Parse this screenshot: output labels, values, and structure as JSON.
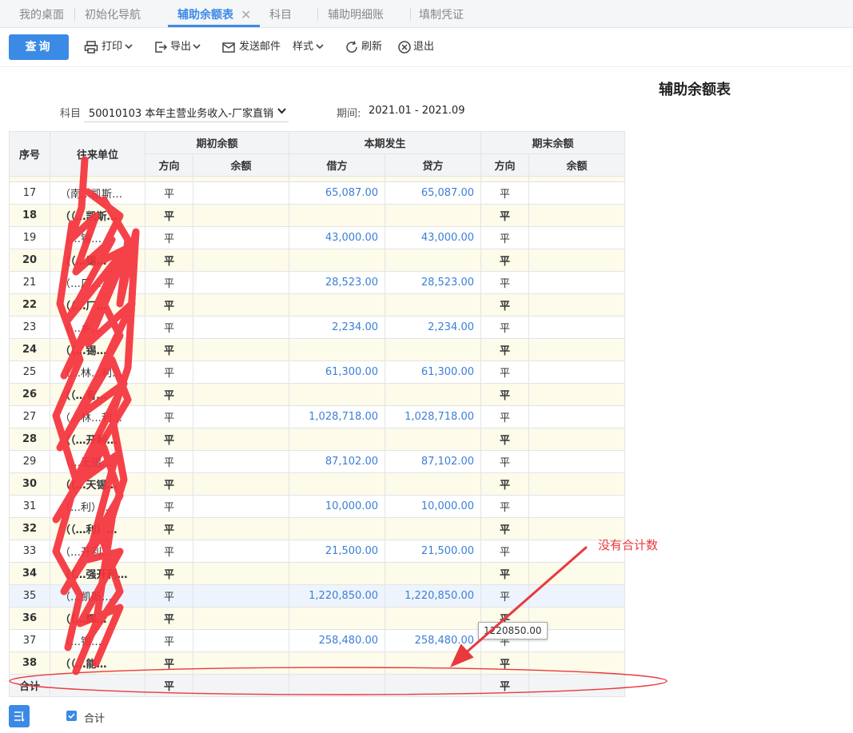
{
  "tabs": [
    {
      "label": "我的桌面"
    },
    {
      "label": "初始化导航"
    },
    {
      "label": "辅助余额表"
    },
    {
      "label": "科目"
    },
    {
      "label": "辅助明细账"
    },
    {
      "label": "填制凭证"
    }
  ],
  "toolbar": {
    "query": "查询",
    "print": "打印",
    "export": "导出",
    "email": "发送邮件",
    "style": "样式",
    "refresh": "刷新",
    "exit": "退出"
  },
  "report": {
    "title": "辅助余额表",
    "subject_label": "科目",
    "subject_value": "50010103 本年主营业务收入-厂家直销",
    "period_label": "期间:",
    "period_value": "2021.01 - 2021.09"
  },
  "table": {
    "headers": {
      "index": "序号",
      "partner": "往来单位",
      "opening": "期初余额",
      "current": "本期发生",
      "closing": "期末余额",
      "direction": "方向",
      "balance": "余额",
      "debit": "借方",
      "credit": "贷方"
    },
    "rows": [
      {
        "idx": "17",
        "name": "（南…凯斯…",
        "dir": "平",
        "debit": "65,087.00",
        "credit": "65,087.00",
        "cdir": "平"
      },
      {
        "idx": "18",
        "name": "（（…凯斯…",
        "dir": "平",
        "debit": "",
        "credit": "",
        "cdir": "平"
      },
      {
        "idx": "19",
        "name": "（…锡…",
        "dir": "平",
        "debit": "43,000.00",
        "credit": "43,000.00",
        "cdir": "平"
      },
      {
        "idx": "20",
        "name": "（（…锡…",
        "dir": "平",
        "debit": "",
        "credit": "",
        "cdir": "平"
      },
      {
        "idx": "21",
        "name": "（…厂…",
        "dir": "平",
        "debit": "28,523.00",
        "credit": "28,523.00",
        "cdir": "平"
      },
      {
        "idx": "22",
        "name": "（（…厂…",
        "dir": "平",
        "debit": "",
        "credit": "",
        "cdir": "平"
      },
      {
        "idx": "23",
        "name": "（…乡…",
        "dir": "平",
        "debit": "2,234.00",
        "credit": "2,234.00",
        "cdir": "平"
      },
      {
        "idx": "24",
        "name": "（（…锡…",
        "dir": "平",
        "debit": "",
        "credit": "",
        "cdir": "平"
      },
      {
        "idx": "25",
        "name": "（…林…利…",
        "dir": "平",
        "debit": "61,300.00",
        "credit": "61,300.00",
        "cdir": "平"
      },
      {
        "idx": "26",
        "name": "（（…有…",
        "dir": "平",
        "debit": "",
        "credit": "",
        "cdir": "平"
      },
      {
        "idx": "27",
        "name": "（…林…利…",
        "dir": "平",
        "debit": "1,028,718.00",
        "credit": "1,028,718.00",
        "cdir": "平"
      },
      {
        "idx": "28",
        "name": "（（…开利…",
        "dir": "平",
        "debit": "",
        "credit": "",
        "cdir": "平"
      },
      {
        "idx": "29",
        "name": "（…无锡…",
        "dir": "平",
        "debit": "87,102.00",
        "credit": "87,102.00",
        "cdir": "平"
      },
      {
        "idx": "30",
        "name": "（（…天锡…",
        "dir": "平",
        "debit": "",
        "credit": "",
        "cdir": "平"
      },
      {
        "idx": "31",
        "name": "（…利）…",
        "dir": "平",
        "debit": "10,000.00",
        "credit": "10,000.00",
        "cdir": "平"
      },
      {
        "idx": "32",
        "name": "（（…利）…",
        "dir": "平",
        "debit": "",
        "credit": "",
        "cdir": "平"
      },
      {
        "idx": "33",
        "name": "（…开利…",
        "dir": "平",
        "debit": "21,500.00",
        "credit": "21,500.00",
        "cdir": "平"
      },
      {
        "idx": "34",
        "name": "（（…强开利…",
        "dir": "平",
        "debit": "",
        "credit": "",
        "cdir": "平"
      },
      {
        "idx": "35",
        "name": "（…凯斯…",
        "dir": "平",
        "debit": "1,220,850.00",
        "credit": "1,220,850.00",
        "cdir": "平"
      },
      {
        "idx": "36",
        "name": "（（…辉…",
        "dir": "平",
        "debit": "",
        "credit": "",
        "cdir": "平"
      },
      {
        "idx": "37",
        "name": "（…锡…",
        "dir": "平",
        "debit": "258,480.00",
        "credit": "258,480.00",
        "cdir": "平"
      },
      {
        "idx": "38",
        "name": "（（…能…",
        "dir": "平",
        "debit": "",
        "credit": "",
        "cdir": "平"
      }
    ],
    "total": {
      "label": "合计",
      "dir": "平",
      "cdir": "平"
    }
  },
  "tooltip": "1220850.00",
  "annotation": "没有合计数",
  "footer": {
    "total_checkbox_label": "合计",
    "total_checked": true
  },
  "colors": {
    "accent": "#3b8ae6",
    "annotation": "#e8393c",
    "amount": "#3b7fd9"
  }
}
